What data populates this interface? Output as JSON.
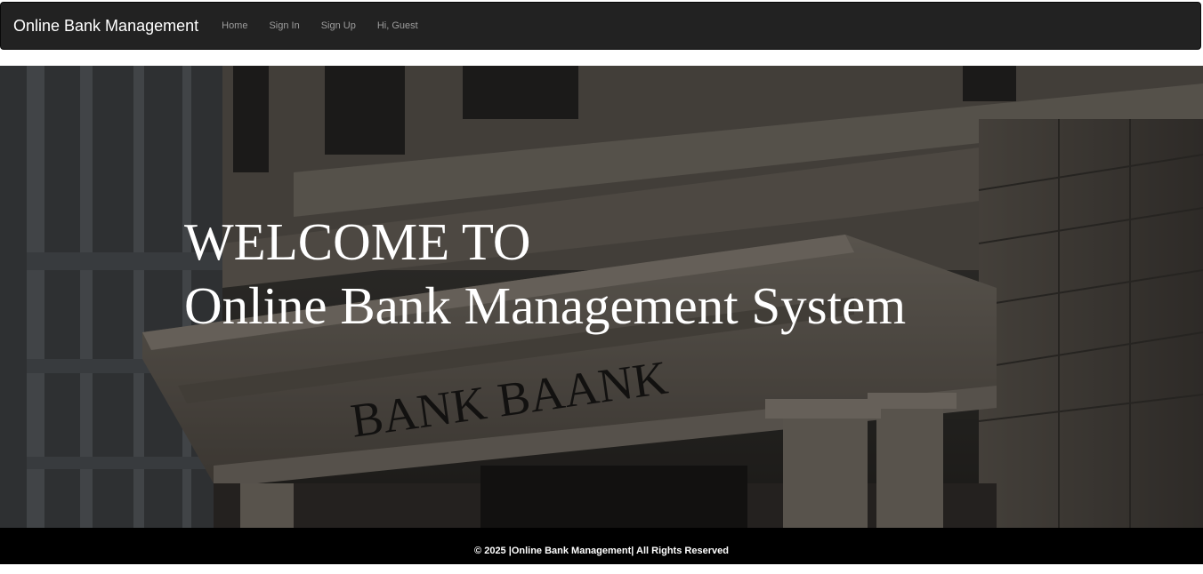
{
  "navbar": {
    "brand": "Online Bank Management",
    "links": [
      {
        "label": "Home"
      },
      {
        "label": "Sign In"
      },
      {
        "label": "Sign Up"
      }
    ],
    "greeting": "Hi, Guest"
  },
  "hero": {
    "line1": "WELCOME TO",
    "line2": "Online Bank Management System",
    "building_sign": "BANK BAANK"
  },
  "footer": {
    "text": "© 2025 |Online Bank Management| All Rights Reserved"
  },
  "colors": {
    "navbar_bg": "#222222",
    "nav_link": "#9d9d9d",
    "footer_bg": "#000000",
    "hero_text": "#ffffff"
  }
}
